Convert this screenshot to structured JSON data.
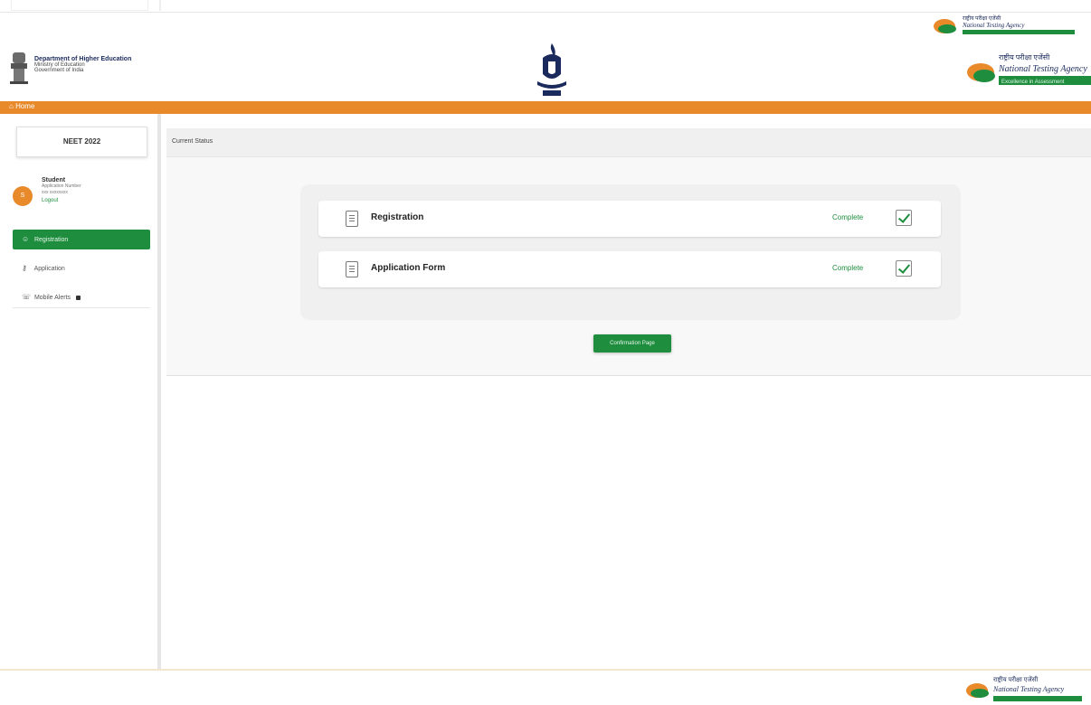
{
  "header": {
    "department": {
      "line1": "Department of Higher Education",
      "line2": "Ministry of Education",
      "line3": "Government of India"
    },
    "nta": {
      "hindi": "राष्ट्रीय परीक्षा एजेंसी",
      "english": "National Testing Agency",
      "tagline": "Excellence in Assessment"
    }
  },
  "nav": {
    "home_label": "Home"
  },
  "sidebar": {
    "exam_title": "NEET 2022",
    "user": {
      "initials": "S",
      "name": "Student",
      "sub1": "Application Number",
      "sub2": "xxx xxxxxxxx",
      "logout": "Logout"
    },
    "items": [
      {
        "label": "Registration",
        "icon": "user-icon",
        "active": true
      },
      {
        "label": "Application",
        "icon": "key-icon",
        "active": false
      },
      {
        "label": "Mobile Alerts",
        "icon": "phone-icon",
        "active": false
      }
    ]
  },
  "main": {
    "breadcrumb": "Current Status",
    "rows": [
      {
        "label": "Registration",
        "status": "Complete",
        "icon": "document-icon",
        "checked": true
      },
      {
        "label": "Application Form",
        "status": "Complete",
        "icon": "document-icon",
        "checked": true
      }
    ],
    "confirm_button": "Confirmation Page"
  },
  "colors": {
    "accent_green": "#1e8e3e",
    "accent_orange": "#e8892a",
    "navy": "#1a2a5c"
  }
}
